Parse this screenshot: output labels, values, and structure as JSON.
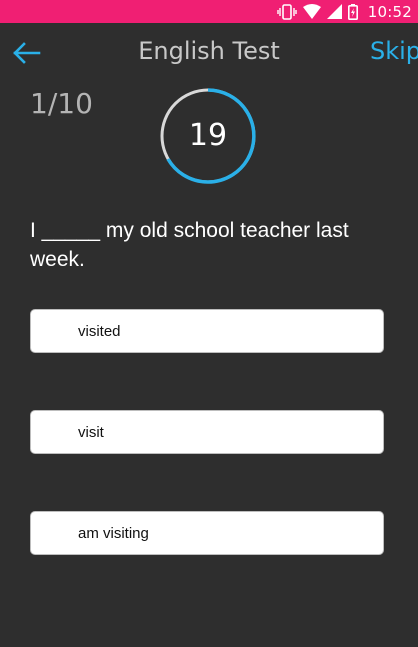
{
  "status_bar": {
    "time": "10:52",
    "icons": [
      "vibrate-icon",
      "wifi-icon",
      "signal-icon",
      "battery-charging-icon"
    ],
    "background_color": "#f01f73"
  },
  "header": {
    "back_icon": "back-arrow-icon",
    "title": "English Test",
    "skip_label": "Skip",
    "accent_color": "#2ab0e8"
  },
  "quiz": {
    "progress": "1/10",
    "timer_value": "19",
    "question": "I _____ my old school teacher last week.",
    "options": [
      {
        "label": "visited"
      },
      {
        "label": "visit"
      },
      {
        "label": "am visiting"
      }
    ]
  }
}
